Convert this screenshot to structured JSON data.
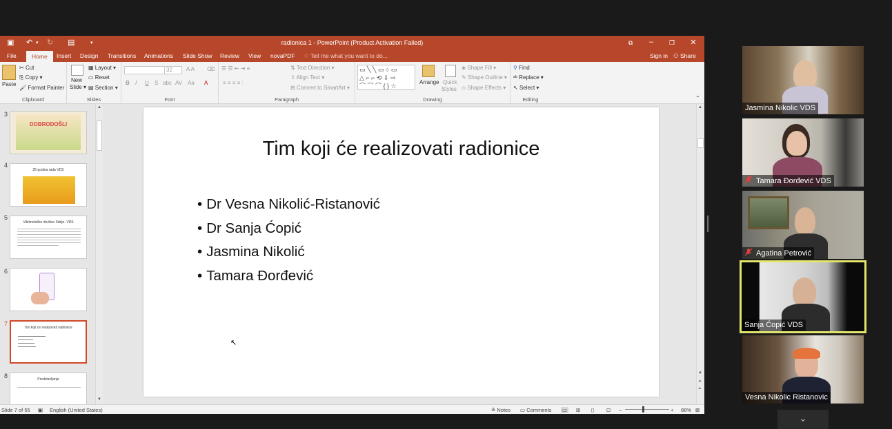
{
  "window": {
    "title": "radionica 1 - PowerPoint (Product Activation Failed)"
  },
  "tabs": [
    "File",
    "Home",
    "Insert",
    "Design",
    "Transitions",
    "Animations",
    "Slide Show",
    "Review",
    "View",
    "novaPDF"
  ],
  "active_tab": "Home",
  "tell_me": "Tell me what you want to do...",
  "sign_in": "Sign in",
  "share": "Share",
  "ribbon": {
    "clipboard": {
      "label": "Clipboard",
      "paste": "Paste",
      "cut": "Cut",
      "copy": "Copy",
      "format_painter": "Format Painter"
    },
    "slides": {
      "label": "Slides",
      "new_slide": "New",
      "new_slide2": "Slide",
      "layout": "Layout",
      "reset": "Reset",
      "section": "Section"
    },
    "font": {
      "label": "Font",
      "size": "32"
    },
    "paragraph": {
      "label": "Paragraph",
      "text_direction": "Text Direction",
      "align_text": "Align Text",
      "convert": "Convert to SmartArt"
    },
    "drawing": {
      "label": "Drawing",
      "arrange": "Arrange",
      "quick_styles": "Quick",
      "quick_styles2": "Styles",
      "shape_fill": "Shape Fill",
      "shape_outline": "Shape Outline",
      "shape_effects": "Shape Effects"
    },
    "editing": {
      "label": "Editing",
      "find": "Find",
      "replace": "Replace",
      "select": "Select"
    }
  },
  "thumbnails": [
    {
      "num": "3",
      "title": "DOBRODOŠLI"
    },
    {
      "num": "4",
      "title": "25 godina rada VDS"
    },
    {
      "num": "5",
      "title": "Viktimološko društvo Srbije- VDS"
    },
    {
      "num": "6",
      "title": ""
    },
    {
      "num": "7",
      "title": "Tim koji će realizovati radionice"
    },
    {
      "num": "8",
      "title": "Predstavljanje"
    }
  ],
  "slide": {
    "title": "Tim koji će realizovati radionice",
    "bullets": [
      "Dr Vesna Nikolić-Ristanović",
      "Dr Sanja Ćopić",
      "Jasmina Nikolić",
      "Tamara Đorđević"
    ]
  },
  "status": {
    "slide_info": "Slide 7 of 55",
    "language": "English (United States)",
    "notes": "Notes",
    "comments": "Comments",
    "zoom": "88%"
  },
  "participants": [
    {
      "name": "Jasmina Nikolic VDS",
      "muted": false
    },
    {
      "name": "Tamara Đorđević VDS",
      "muted": true
    },
    {
      "name": "Agatina Petrović",
      "muted": true
    },
    {
      "name": "Sanja Ćopić VDS",
      "muted": false
    },
    {
      "name": "Vesna Nikolic Ristanovic",
      "muted": false
    }
  ],
  "colors": {
    "ppt_accent": "#b7472a",
    "active_speaker": "#e3e66b",
    "muted_icon": "#e04040"
  }
}
